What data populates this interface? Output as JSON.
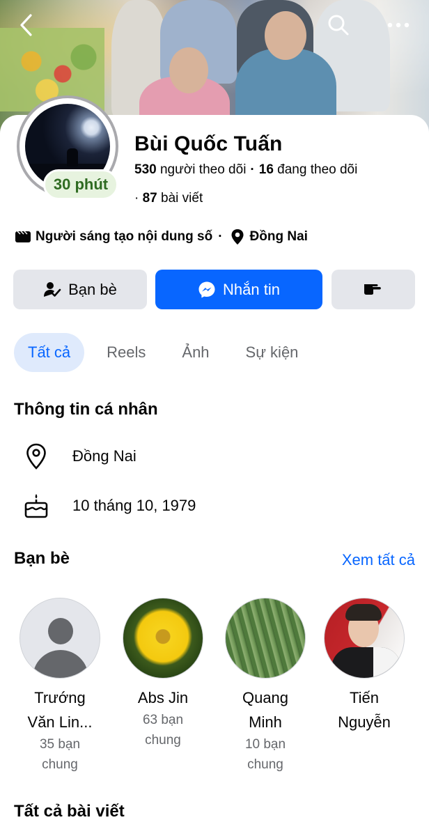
{
  "profile": {
    "name": "Bùi Quốc Tuấn",
    "story_time": "30 phút",
    "followers_count": "530",
    "followers_label": "người theo dõi",
    "following_count": "16",
    "following_label": "đang theo dõi",
    "posts_count": "87",
    "posts_label": "bài viết",
    "category": "Người sáng tạo nội dung số",
    "location": "Đồng Nai"
  },
  "actions": {
    "friends_label": "Bạn bè",
    "message_label": "Nhắn tin"
  },
  "tabs": [
    {
      "label": "Tất cả",
      "active": true
    },
    {
      "label": "Reels",
      "active": false
    },
    {
      "label": "Ảnh",
      "active": false
    },
    {
      "label": "Sự kiện",
      "active": false
    }
  ],
  "personal_info": {
    "title": "Thông tin cá nhân",
    "location": "Đồng Nai",
    "birthday": "10 tháng 10, 1979"
  },
  "friends": {
    "title": "Bạn bè",
    "see_all": "Xem tất cả",
    "items": [
      {
        "name_line1": "Trướng",
        "name_line2": "Văn Lin...",
        "mutual_line1": "35 bạn",
        "mutual_line2": "chung"
      },
      {
        "name_line1": "Abs Jin",
        "name_line2": "",
        "mutual_line1": "63 bạn",
        "mutual_line2": "chung"
      },
      {
        "name_line1": "Quang",
        "name_line2": "Minh",
        "mutual_line1": "10 bạn",
        "mutual_line2": "chung"
      },
      {
        "name_line1": "Tiến",
        "name_line2": "Nguyễn",
        "mutual_line1": "",
        "mutual_line2": ""
      }
    ]
  },
  "posts_section": {
    "title": "Tất cả bài viết"
  },
  "colors": {
    "accent": "#0866ff",
    "button_gray": "#e4e6eb",
    "secondary_text": "#65676b",
    "story_green": "#2f6b22"
  },
  "icons": [
    "back-icon",
    "search-icon",
    "more-icon",
    "digital-creator-icon",
    "location-pin-icon",
    "friend-check-icon",
    "messenger-icon",
    "poke-icon",
    "birthday-cake-icon"
  ]
}
